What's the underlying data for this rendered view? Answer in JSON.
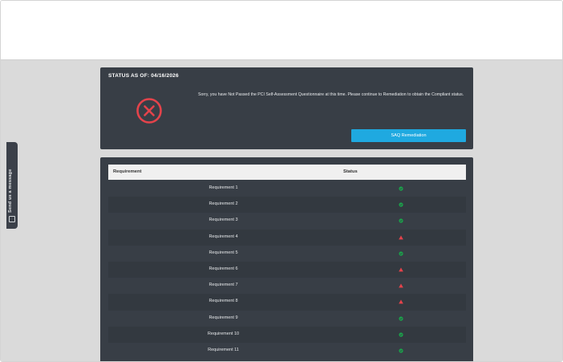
{
  "feedback": {
    "label": "Send us a message",
    "icon": "message-icon"
  },
  "status": {
    "title": "STATUS AS OF: 04/16/2026",
    "icon": "fail-x-icon",
    "message": "Sorry, you have Not Passed the PCI Self-Assessment Questionnaire at this time. Please continue to Remediation to obtain the Compliant status.",
    "button_label": "SAQ Remediation",
    "colors": {
      "fail": "#e4434b",
      "button": "#1fa9e0",
      "card": "#383e46"
    }
  },
  "requirements": {
    "headers": {
      "requirement": "Requirement",
      "status": "Status"
    },
    "rows": [
      {
        "name": "Requirement 1",
        "status": "pass"
      },
      {
        "name": "Requirement 2",
        "status": "pass"
      },
      {
        "name": "Requirement 3",
        "status": "pass"
      },
      {
        "name": "Requirement 4",
        "status": "fail"
      },
      {
        "name": "Requirement 5",
        "status": "pass"
      },
      {
        "name": "Requirement 6",
        "status": "fail"
      },
      {
        "name": "Requirement 7",
        "status": "fail"
      },
      {
        "name": "Requirement 8",
        "status": "fail"
      },
      {
        "name": "Requirement 9",
        "status": "pass"
      },
      {
        "name": "Requirement 10",
        "status": "pass"
      },
      {
        "name": "Requirement 11",
        "status": "pass"
      }
    ],
    "colors": {
      "pass": "#1aa34a",
      "fail": "#e4434b"
    }
  }
}
